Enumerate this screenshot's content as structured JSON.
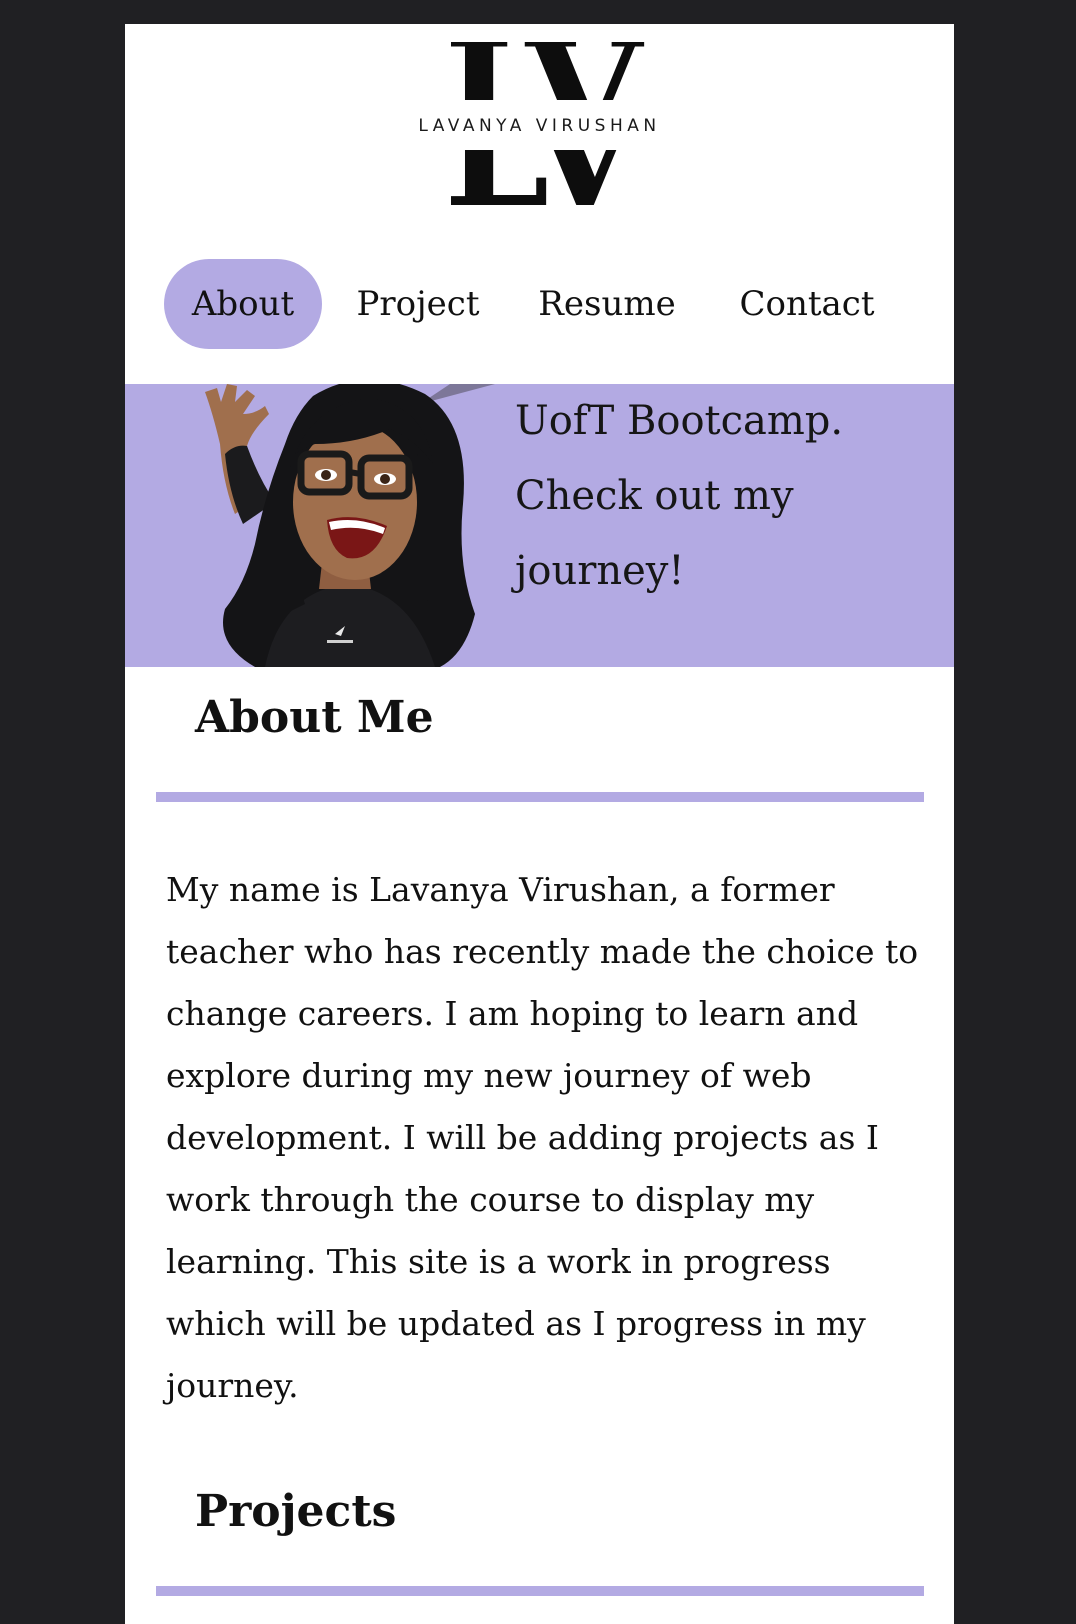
{
  "logo": {
    "monogram": "LV",
    "name": "LAVANYA VIRUSHAN"
  },
  "nav": {
    "items": [
      {
        "label": "About",
        "active": true
      },
      {
        "label": "Project",
        "active": false
      },
      {
        "label": "Resume",
        "active": false
      },
      {
        "label": "Contact",
        "active": false
      }
    ]
  },
  "banner": {
    "lines": [
      "UofT Bootcamp.",
      "Check out my",
      "journey!"
    ],
    "avatar_icon": "bitmoji-avatar-waving"
  },
  "about": {
    "title": "About Me",
    "body": "My name is Lavanya Virushan, a former teacher who has recently made the choice to change careers. I am hoping to learn and explore during my new journey of web development. I will be adding projects as I work through the course to display my learning. This site is a work in progress which will be updated as I progress in my journey."
  },
  "projects": {
    "title": "Projects"
  },
  "colors": {
    "accent": "#b3aae3",
    "page_background": "#202023",
    "content_background": "#ffffff",
    "text": "#111111"
  }
}
